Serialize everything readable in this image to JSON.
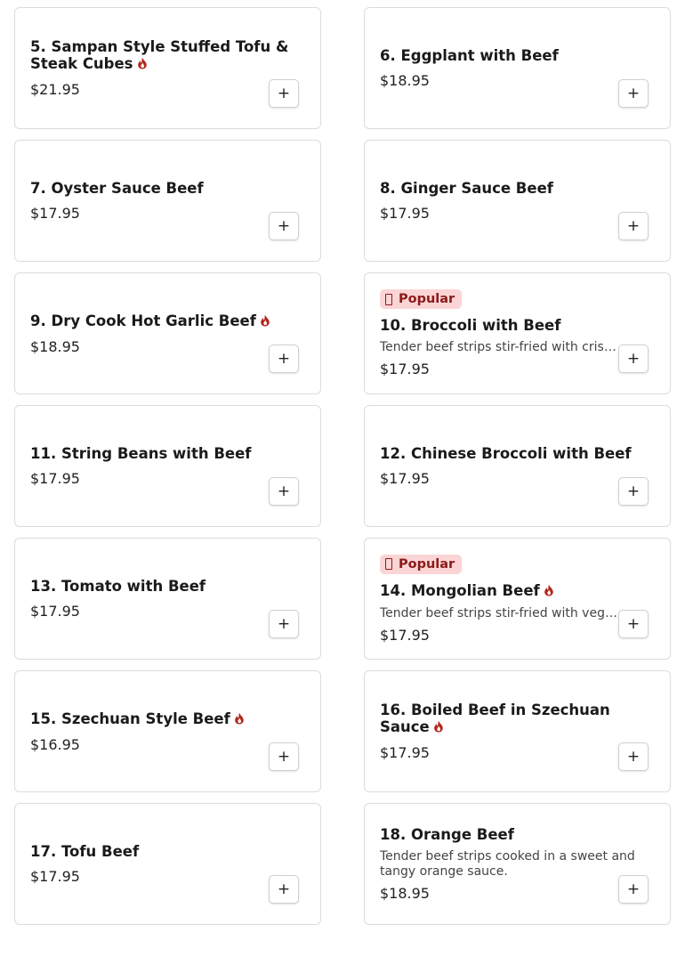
{
  "ui": {
    "spicy_icon_color": "#b3261e",
    "badge_bg": "#fbd5d5",
    "badge_text_color": "#8b1a1a",
    "add_symbol": "+"
  },
  "menu": {
    "items": [
      {
        "title": "5. Sampan Style Stuffed Tofu & Steak Cubes",
        "price": "$21.95",
        "spicy": true,
        "badge": "",
        "desc": ""
      },
      {
        "title": "6. Eggplant with Beef",
        "price": "$18.95",
        "spicy": false,
        "badge": "",
        "desc": ""
      },
      {
        "title": "7. Oyster Sauce Beef",
        "price": "$17.95",
        "spicy": false,
        "badge": "",
        "desc": ""
      },
      {
        "title": "8. Ginger Sauce Beef",
        "price": "$17.95",
        "spicy": false,
        "badge": "",
        "desc": ""
      },
      {
        "title": "9. Dry Cook Hot Garlic Beef",
        "price": "$18.95",
        "spicy": true,
        "badge": "",
        "desc": ""
      },
      {
        "title": "10. Broccoli with Beef",
        "price": "$17.95",
        "spicy": false,
        "badge": "Popular",
        "desc": "Tender beef strips stir-fried with crisp broccoli florets."
      },
      {
        "title": "11. String Beans with Beef",
        "price": "$17.95",
        "spicy": false,
        "badge": "",
        "desc": ""
      },
      {
        "title": "12. Chinese Broccoli with Beef",
        "price": "$17.95",
        "spicy": false,
        "badge": "",
        "desc": ""
      },
      {
        "title": "13. Tomato with Beef",
        "price": "$17.95",
        "spicy": false,
        "badge": "",
        "desc": ""
      },
      {
        "title": "14. Mongolian Beef",
        "price": "$17.95",
        "spicy": true,
        "badge": "Popular",
        "desc": "Tender beef strips stir-fried with vegetables."
      },
      {
        "title": "15. Szechuan Style Beef",
        "price": "$16.95",
        "spicy": true,
        "badge": "",
        "desc": ""
      },
      {
        "title": "16. Boiled Beef in Szechuan Sauce",
        "price": "$17.95",
        "spicy": true,
        "badge": "",
        "desc": ""
      },
      {
        "title": "17. Tofu Beef",
        "price": "$17.95",
        "spicy": false,
        "badge": "",
        "desc": ""
      },
      {
        "title": "18. Orange Beef",
        "price": "$18.95",
        "spicy": false,
        "badge": "",
        "desc": "Tender beef strips cooked in a sweet and tangy orange sauce.",
        "desc_wrap": true
      }
    ]
  }
}
